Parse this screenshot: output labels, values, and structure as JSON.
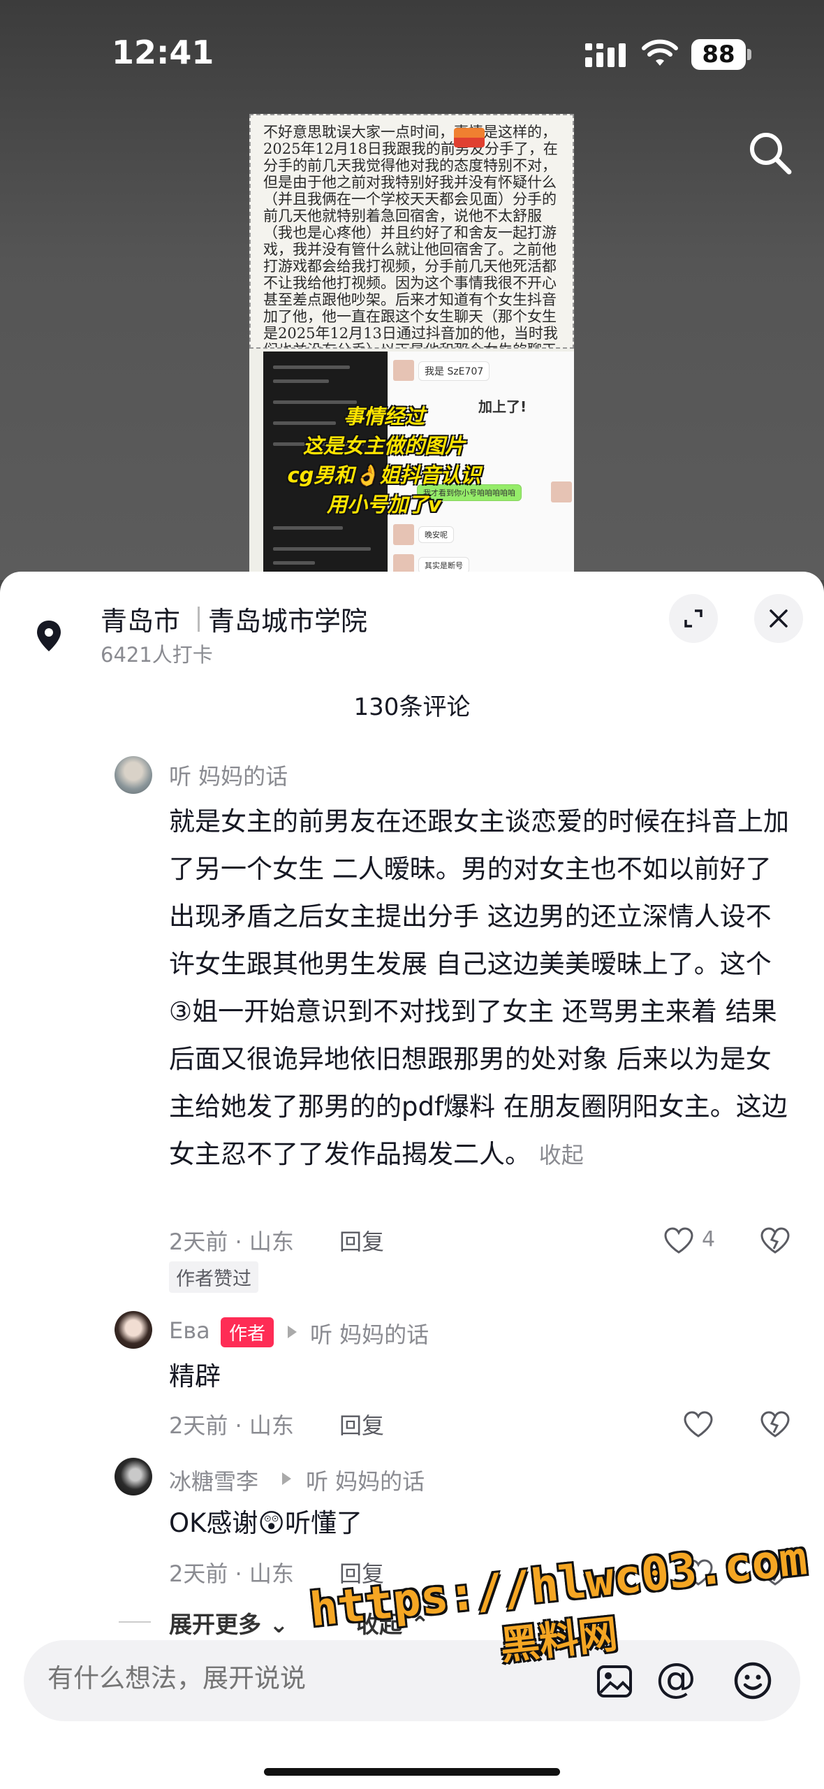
{
  "status_bar": {
    "time": "12:41",
    "battery": "88"
  },
  "video": {
    "doc_text": "不好意思耽误大家一点时间，事情是这样的，2025年12月18日我跟我的前男友分手了，在分手的前几天我觉得他对我的态度特别不对，但是由于他之前对我特别好我并没有怀疑什么（并且我俩在一个学校天天都会见面）分手的前几天他就特别着急回宿舍，说他不太舒服（我也是心疼他）并且约好了和舍友一起打游戏，我并没有管什么就让他回宿舍了。之前他打游戏都会给我打视频，分手前几天他死活都不让我给他打视频。因为这个事情我很不开心甚至差点跟他吵架。后来才知道有个女生抖音加了他，他一直在跟这个女生聊天（那个女生是2025年12月13日通过抖音加的他，当时我们也并没有分手）以下是他和那个女生的聊天记录（是他女朋友发的抖音我才发现我被绿了）：",
    "chat_bubbles": [
      "我是 SzE707",
      "加上了!",
      "我才看到你小号咱咱咱咱咱",
      "晚安呢",
      "其实是断号"
    ],
    "caption_lines": [
      "事情经过",
      "这是女主做的图片",
      "cg男和👌姐抖音认识",
      "用小号加了v"
    ]
  },
  "sheet": {
    "location_city": "青岛市",
    "location_school": "青岛城市学院",
    "checkin_count": "6421人打卡",
    "comment_count": "130条评论"
  },
  "comments": [
    {
      "username": "听 妈妈的话",
      "text": "就是女主的前男友在还跟女主谈恋爱的时候在抖音上加了另一个女生 二人暧昧。男的对女主也不如以前好了 出现矛盾之后女主提出分手 这边男的还立深情人设不许女生跟其他男生发展 自己这边美美暧昧上了。这个③姐一开始意识到不对找到了女主 还骂男主来着 结果后面又很诡异地依旧想跟那男的处对象 后来以为是女主给她发了那男的的pdf爆料 在朋友圈阴阳女主。这边女主忍不了了发作品揭发二人。",
      "collapse": "收起",
      "time": "2天前 · 山东",
      "reply": "回复",
      "likes": "4",
      "author_liked": "作者赞过"
    },
    {
      "username": "Ева",
      "badge": "作者",
      "reply_to": "听 妈妈的话",
      "text": "精辟",
      "time": "2天前 · 山东",
      "reply": "回复"
    },
    {
      "username": "冰糖雪李",
      "reply_to": "听 妈妈的话",
      "text": "OK感谢😲听懂了",
      "time": "2天前 · 山东",
      "reply": "回复"
    }
  ],
  "expand_more": "展开更多",
  "collapse_replies": "收起",
  "input": {
    "placeholder": "有什么想法，展开说说"
  },
  "icons": {
    "mention": "@",
    "location": "location-pin-icon",
    "search": "search-icon",
    "close": "close-icon",
    "expand": "expand-icon",
    "heart": "heart-icon",
    "dislike": "broken-heart-icon",
    "emoji": "emoji-icon",
    "image": "image-icon"
  },
  "watermark": {
    "url": "https://hlwc03.com",
    "name": "黑料网"
  },
  "colors": {
    "author_badge": "#fe2c55",
    "watermark": "#f5a623",
    "caption": "#ffe400"
  }
}
